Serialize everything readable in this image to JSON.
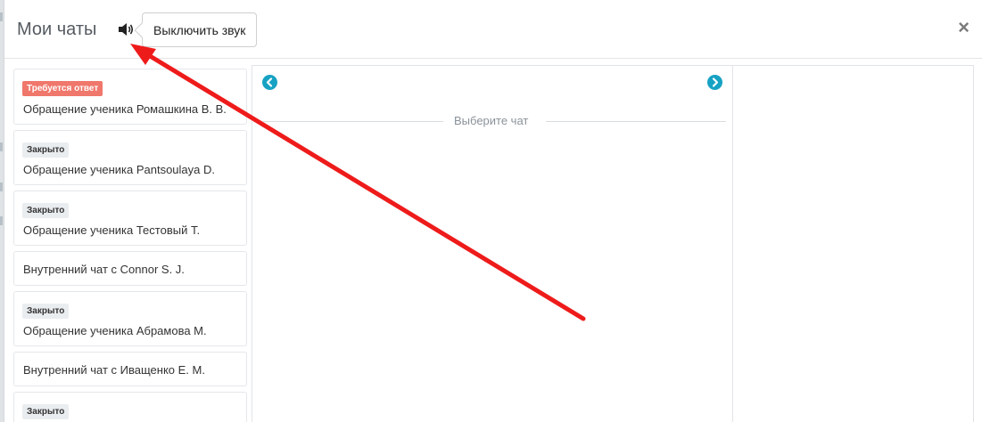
{
  "header": {
    "title": "Мои чаты",
    "sound_icon": "speaker-icon",
    "tooltip": "Выключить звук",
    "close_symbol": "×"
  },
  "chats": [
    {
      "badge": "Требуется ответ",
      "badge_color": "#f0776b",
      "name": "Обращение ученика Ромашкина В. В."
    },
    {
      "badge": "Закрыто",
      "badge_color": "#eaedf0",
      "name": "Обращение ученика Pantsoulaya D."
    },
    {
      "badge": "Закрыто",
      "badge_color": "#eaedf0",
      "name": "Обращение ученика Тестовый Т."
    },
    {
      "badge": "",
      "name": "Внутренний чат с Connor S. J."
    },
    {
      "badge": "Закрыто",
      "badge_color": "#eaedf0",
      "name": "Обращение ученика Абрамова М."
    },
    {
      "badge": "",
      "name": "Внутренний чат с Иващенко Е. М."
    },
    {
      "badge": "Закрыто",
      "badge_color": "#eaedf0",
      "name": ""
    }
  ],
  "chat_panel": {
    "placeholder": "Выберите чат",
    "prev_icon": "chevron-left-icon",
    "next_icon": "chevron-right-icon"
  },
  "colors": {
    "accent": "#17a2c4",
    "annotation_arrow": "#ee1b1b"
  }
}
